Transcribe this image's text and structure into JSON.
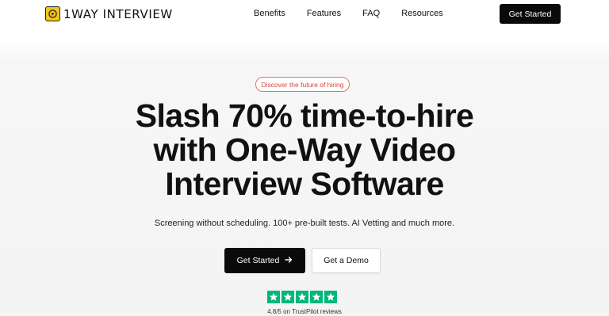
{
  "header": {
    "brand": "1WAY INTERVIEW",
    "nav": [
      "Benefits",
      "Features",
      "FAQ",
      "Resources"
    ],
    "cta_label": "Get Started"
  },
  "hero": {
    "badge": "Discover the future of hiring",
    "headline_line1": "Slash 70% time-to-hire",
    "headline_line2": "with One-Way Video",
    "headline_line3": "Interview Software",
    "subheadline": "Screening without scheduling. 100+ pre-built tests. AI Vetting and much more.",
    "primary_cta": "Get Started",
    "secondary_cta": "Get a Demo"
  },
  "rating": {
    "stars": 5,
    "text": "4.8/5 on TrustPilot reviews"
  },
  "colors": {
    "brand_yellow": "#f5c518",
    "accent_red": "#d2453c",
    "trustpilot_green": "#00b67a",
    "dark": "#0a0a0a"
  },
  "icons": [
    "play-logo-icon",
    "arrow-right-icon",
    "star-icon"
  ]
}
